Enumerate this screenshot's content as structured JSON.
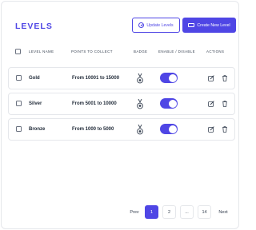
{
  "header": {
    "title": "LEVELS",
    "update_label": "Update Levels",
    "create_label": "Create New Level"
  },
  "table": {
    "columns": [
      "LEVEL NAME",
      "POINTS TO COLLECT",
      "BADGE",
      "ENABLE / DISABLE",
      "ACTIONS"
    ],
    "rows": [
      {
        "name": "Gold",
        "points": "From 10001 to 15000",
        "enabled": true
      },
      {
        "name": "Silver",
        "points": "From 5001 to 10000",
        "enabled": true
      },
      {
        "name": "Bronze",
        "points": "From 1000 to 5000",
        "enabled": true
      }
    ]
  },
  "pagination": {
    "prev": "Prev",
    "pages": [
      "1",
      "2",
      "...",
      "14"
    ],
    "current": "1",
    "next": "Next"
  },
  "colors": {
    "accent": "#4f46e5"
  },
  "icons": {
    "update": "check-circle-icon",
    "create": "layers-icon",
    "badge": "medal-icon",
    "edit": "edit-icon",
    "delete": "trash-icon"
  }
}
